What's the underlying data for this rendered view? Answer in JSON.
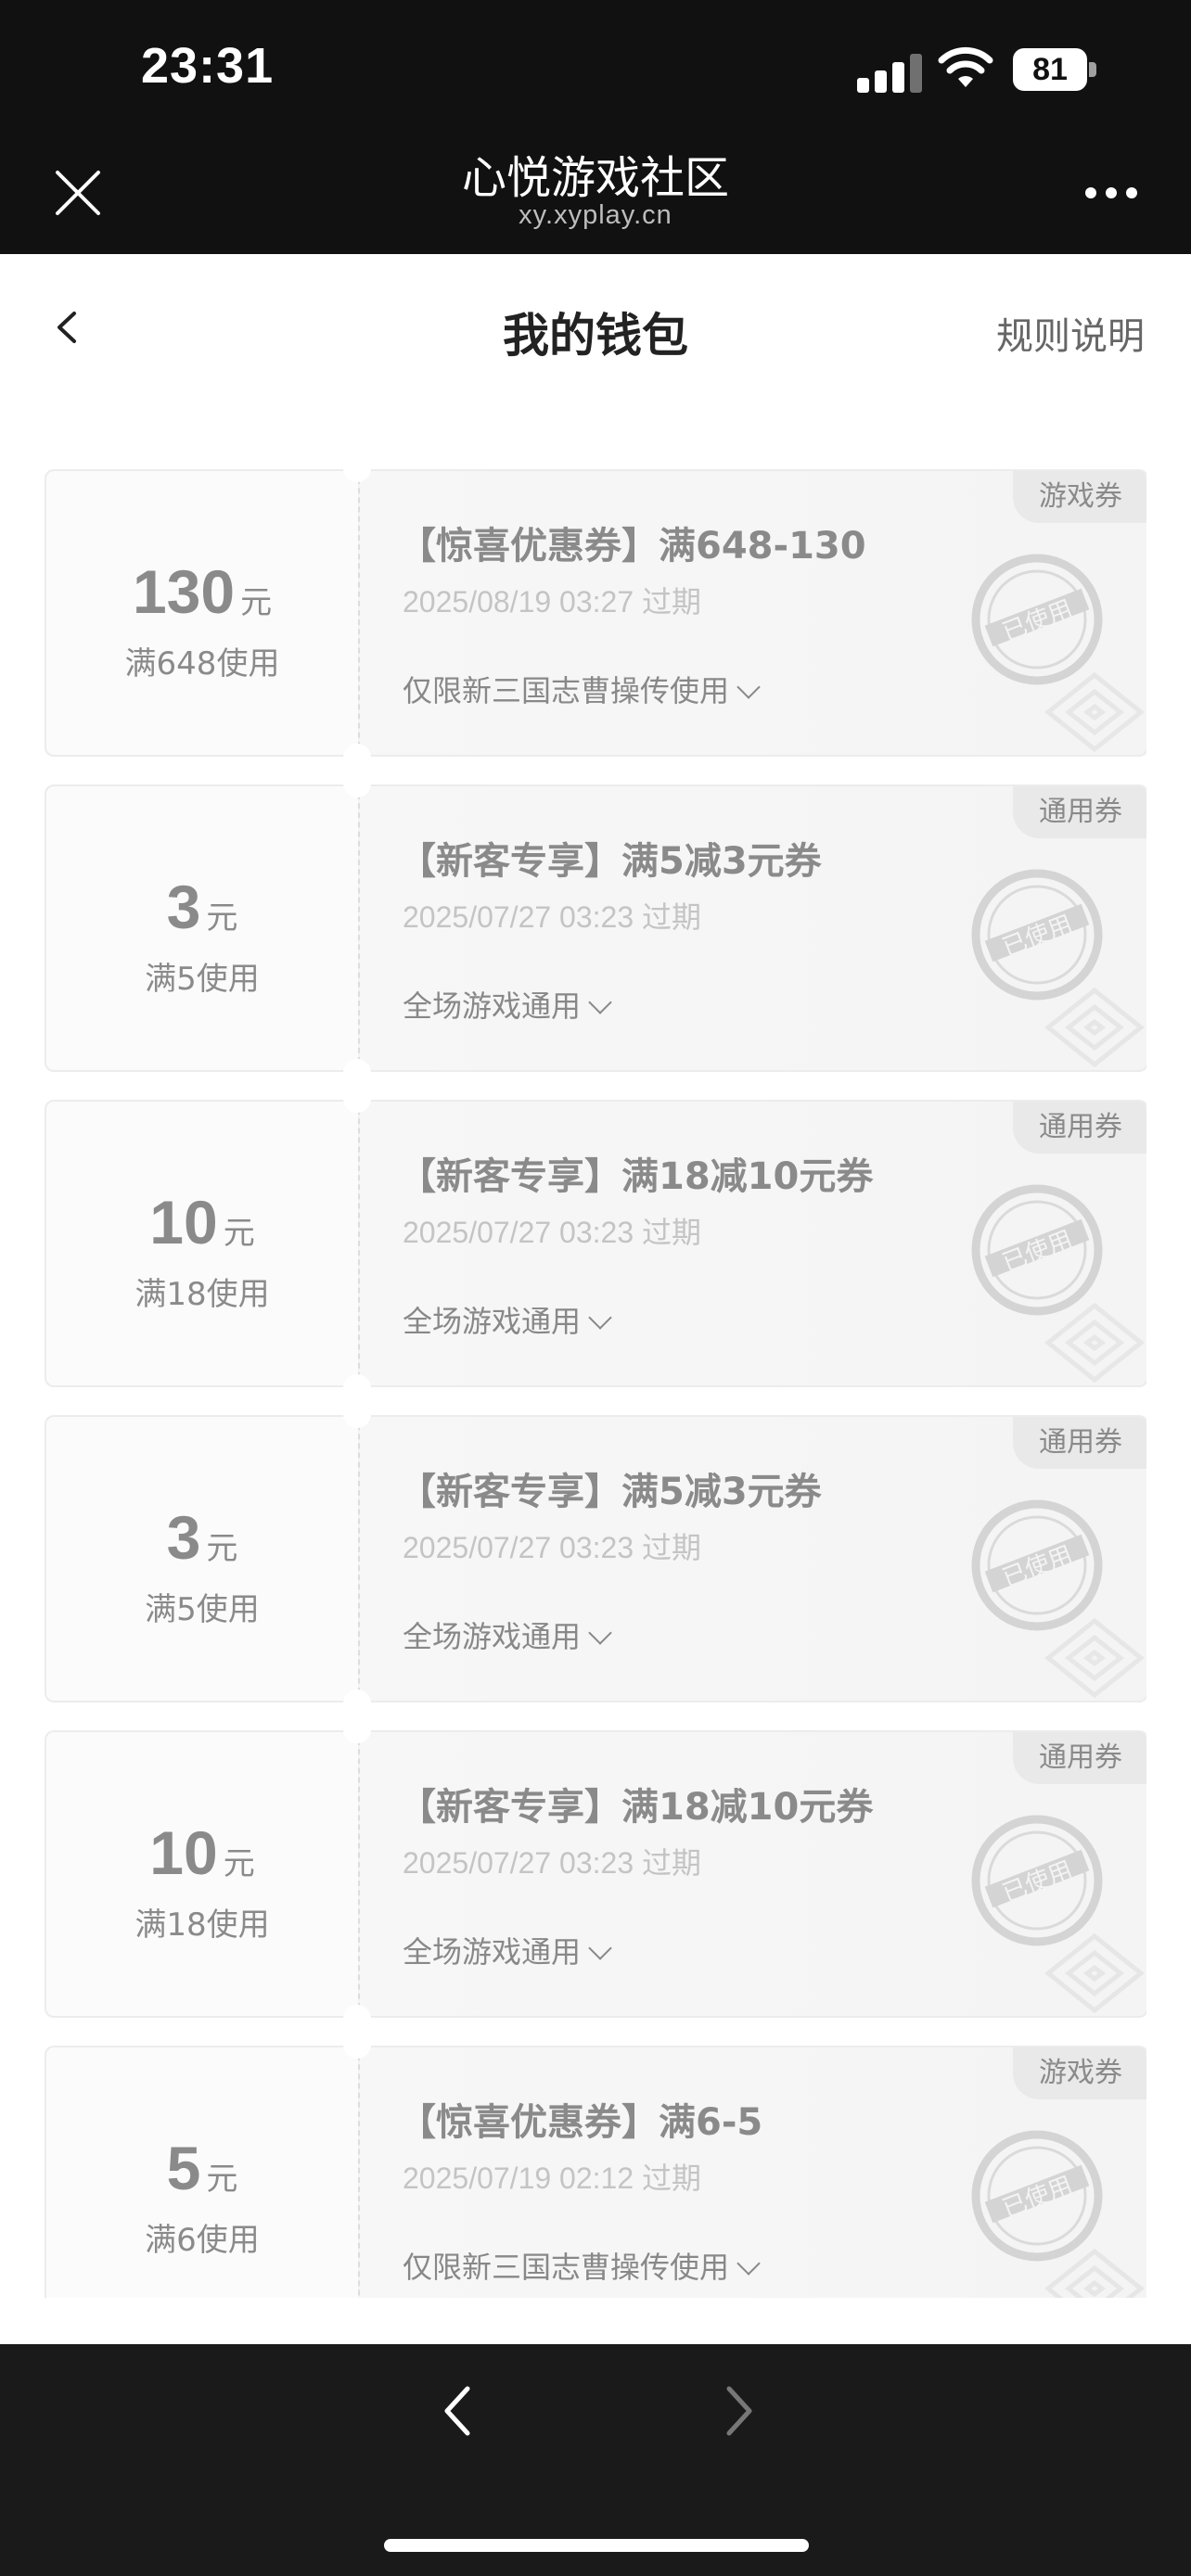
{
  "status_bar": {
    "time": "23:31",
    "battery": "81"
  },
  "browser": {
    "title": "心悦游戏社区",
    "url": "xy.xyplay.cn"
  },
  "page": {
    "title": "我的钱包",
    "rules_label": "规则说明"
  },
  "coupons": [
    {
      "amount": "130",
      "unit": "元",
      "condition": "满648使用",
      "title": "【惊喜优惠券】满648-130",
      "expiry": "2025/08/19 03:27 过期",
      "scope": "仅限新三国志曹操传使用",
      "type": "游戏券",
      "status": "已使用"
    },
    {
      "amount": "3",
      "unit": "元",
      "condition": "满5使用",
      "title": "【新客专享】满5减3元券",
      "expiry": "2025/07/27 03:23 过期",
      "scope": "全场游戏通用",
      "type": "通用券",
      "status": "已使用"
    },
    {
      "amount": "10",
      "unit": "元",
      "condition": "满18使用",
      "title": "【新客专享】满18减10元券",
      "expiry": "2025/07/27 03:23 过期",
      "scope": "全场游戏通用",
      "type": "通用券",
      "status": "已使用"
    },
    {
      "amount": "3",
      "unit": "元",
      "condition": "满5使用",
      "title": "【新客专享】满5减3元券",
      "expiry": "2025/07/27 03:23 过期",
      "scope": "全场游戏通用",
      "type": "通用券",
      "status": "已使用"
    },
    {
      "amount": "10",
      "unit": "元",
      "condition": "满18使用",
      "title": "【新客专享】满18减10元券",
      "expiry": "2025/07/27 03:23 过期",
      "scope": "全场游戏通用",
      "type": "通用券",
      "status": "已使用"
    },
    {
      "amount": "5",
      "unit": "元",
      "condition": "满6使用",
      "title": "【惊喜优惠券】满6-5",
      "expiry": "2025/07/19 02:12 过期",
      "scope": "仅限新三国志曹操传使用",
      "type": "游戏券",
      "status": "已使用"
    }
  ],
  "icons": {
    "close": "close-icon",
    "more": "more-icon",
    "back": "chevron-left-icon",
    "nav_back": "chevron-left-icon",
    "nav_forward": "chevron-right-icon"
  },
  "colors": {
    "top_bar": "#111111",
    "bottom_bar": "#1a1a1a",
    "coupon_text": "#8a8a8a",
    "expiry_text": "#c4c4c4"
  }
}
